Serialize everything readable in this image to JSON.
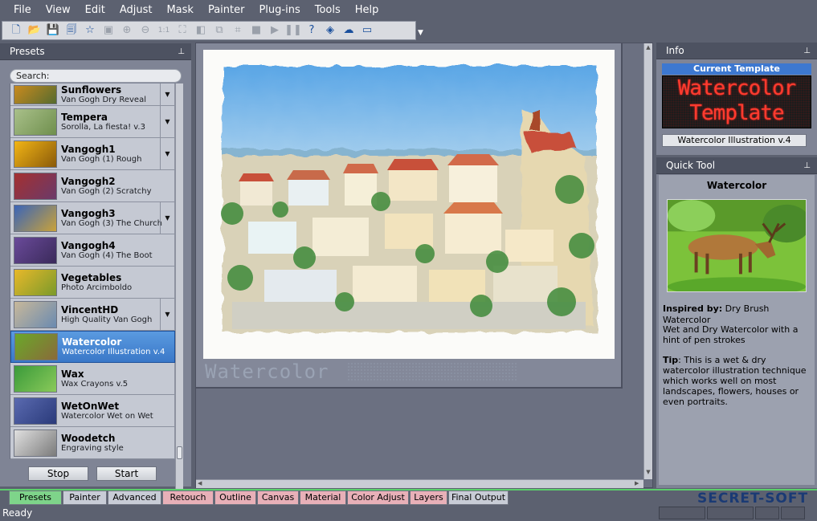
{
  "menu": [
    "File",
    "View",
    "Edit",
    "Adjust",
    "Mask",
    "Painter",
    "Plug-ins",
    "Tools",
    "Help"
  ],
  "toolbar": [
    {
      "name": "new-icon",
      "glyph": "🗋",
      "enabled": true
    },
    {
      "name": "open-icon",
      "glyph": "📂",
      "enabled": true
    },
    {
      "name": "save-icon",
      "glyph": "💾",
      "enabled": true
    },
    {
      "name": "save-as-icon",
      "glyph": "🗐",
      "enabled": true
    },
    {
      "name": "favorite-star-icon",
      "glyph": "☆",
      "enabled": true
    },
    {
      "name": "camera-icon",
      "glyph": "▣",
      "enabled": false
    },
    {
      "name": "zoom-in-icon",
      "glyph": "⊕",
      "enabled": false
    },
    {
      "name": "zoom-out-icon",
      "glyph": "⊖",
      "enabled": false
    },
    {
      "name": "actual-size-icon",
      "glyph": "1:1",
      "enabled": false
    },
    {
      "name": "fit-window-icon",
      "glyph": "⛶",
      "enabled": false
    },
    {
      "name": "compare-icon",
      "glyph": "◧",
      "enabled": false
    },
    {
      "name": "copy-icon",
      "glyph": "⧉",
      "enabled": false
    },
    {
      "name": "crop-icon",
      "glyph": "⌗",
      "enabled": false
    },
    {
      "name": "stop-icon",
      "glyph": "■",
      "enabled": false
    },
    {
      "name": "play-icon",
      "glyph": "▶",
      "enabled": false
    },
    {
      "name": "pause-icon",
      "glyph": "❚❚",
      "enabled": false
    },
    {
      "name": "help-icon",
      "glyph": "?",
      "enabled": true
    },
    {
      "name": "eraser-icon",
      "glyph": "◈",
      "enabled": true
    },
    {
      "name": "cloud-download-icon",
      "glyph": "☁",
      "enabled": true
    },
    {
      "name": "fullscreen-icon",
      "glyph": "▭",
      "enabled": true
    }
  ],
  "presets": {
    "title": "Presets",
    "search_placeholder": "Search:",
    "items": [
      {
        "name": "Sunflowers",
        "sub": "Van Gogh Dry Reveal",
        "dropdown": true,
        "selected": false,
        "thumb": [
          "#c98a1e",
          "#556b2f"
        ]
      },
      {
        "name": "Tempera",
        "sub": "Sorolla, La fiesta! v.3",
        "dropdown": true,
        "selected": false,
        "thumb": [
          "#a9c08a",
          "#6f8f4d"
        ]
      },
      {
        "name": "Vangogh1",
        "sub": "Van Gogh (1) Rough",
        "dropdown": true,
        "selected": false,
        "thumb": [
          "#f2b515",
          "#8a5a0a"
        ]
      },
      {
        "name": "Vangogh2",
        "sub": "Van Gogh (2) Scratchy",
        "dropdown": false,
        "selected": false,
        "thumb": [
          "#a43030",
          "#6a3a6a"
        ]
      },
      {
        "name": "Vangogh3",
        "sub": "Van Gogh (3) The Church",
        "dropdown": true,
        "selected": false,
        "thumb": [
          "#3a64b8",
          "#c9a23a"
        ]
      },
      {
        "name": "Vangogh4",
        "sub": "Van Gogh (4) The Boot",
        "dropdown": false,
        "selected": false,
        "thumb": [
          "#6a4a9a",
          "#3a2a5a"
        ]
      },
      {
        "name": "Vegetables",
        "sub": "Photo Arcimboldo",
        "dropdown": false,
        "selected": false,
        "thumb": [
          "#e8b82a",
          "#7a9a2a"
        ]
      },
      {
        "name": "VincentHD",
        "sub": "High Quality Van Gogh",
        "dropdown": true,
        "selected": false,
        "thumb": [
          "#c8b89a",
          "#6a8ab0"
        ]
      },
      {
        "name": "Watercolor",
        "sub": "Watercolor Illustration v.4",
        "dropdown": false,
        "selected": true,
        "thumb": [
          "#6aa82a",
          "#8a6a3a"
        ]
      },
      {
        "name": "Wax",
        "sub": "Wax Crayons v.5",
        "dropdown": false,
        "selected": false,
        "thumb": [
          "#3a9a3a",
          "#8aca5a"
        ]
      },
      {
        "name": "WetOnWet",
        "sub": "Watercolor Wet on Wet",
        "dropdown": false,
        "selected": false,
        "thumb": [
          "#5a6ab0",
          "#2a3a7a"
        ]
      },
      {
        "name": "Woodetch",
        "sub": "Engraving style",
        "dropdown": false,
        "selected": false,
        "thumb": [
          "#e0e0e0",
          "#7a7a7a"
        ]
      }
    ],
    "stop_label": "Stop",
    "start_label": "Start"
  },
  "canvas": {
    "caption": "Watercolor"
  },
  "info": {
    "title": "Info",
    "current_template_label": "Current Template",
    "led_line1": "Watercolor",
    "led_line2": "Template",
    "template_name": "Watercolor Illustration v.4"
  },
  "quick_tool": {
    "title": "Quick Tool",
    "heading": "Watercolor",
    "inspired_label": "Inspired by:",
    "inspired_value": "Dry Brush Watercolor",
    "description": "Wet and Dry Watercolor with a hint of pen strokes",
    "tip_label": "Tip",
    "tip_text": ": This is a wet & dry watercolor illustration technique which works well on most landscapes, flowers, houses or even portraits."
  },
  "tabs": [
    {
      "label": "Presets",
      "color": "#7ed48a",
      "active": true
    },
    {
      "label": "Painter",
      "color": "#c8ccd6",
      "active": false
    },
    {
      "label": "Advanced",
      "color": "#c8ccd6",
      "active": false
    },
    {
      "label": "Retouch",
      "color": "#e8b0b8",
      "active": false
    },
    {
      "label": "Outline",
      "color": "#e8b0b8",
      "active": false
    },
    {
      "label": "Canvas",
      "color": "#e8b0b8",
      "active": false
    },
    {
      "label": "Material",
      "color": "#e8b0b8",
      "active": false
    },
    {
      "label": "Color Adjust",
      "color": "#e8b0b8",
      "active": false
    },
    {
      "label": "Layers",
      "color": "#e8b0b8",
      "active": false
    },
    {
      "label": "Final Output",
      "color": "#c8ccd6",
      "active": false
    }
  ],
  "brand": "SECRET-SOFT",
  "status": "Ready"
}
